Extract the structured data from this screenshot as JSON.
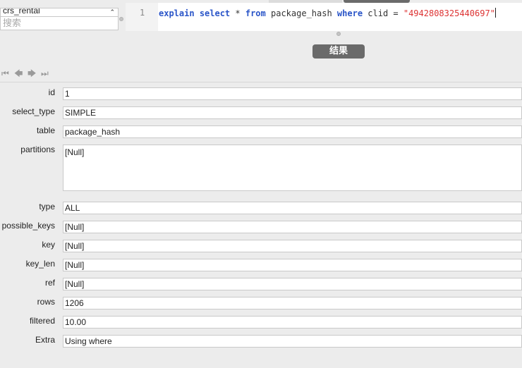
{
  "sidebar": {
    "database_select": "crs_rental",
    "search_placeholder": "搜索"
  },
  "editor": {
    "line_number": "1",
    "tokens": {
      "k1": "explain",
      "k2": "select",
      "t1": " * ",
      "k3": "from",
      "t2": " package_hash ",
      "k4": "where",
      "t3": " clid = ",
      "s1": "\"4942808325440697\""
    }
  },
  "toolbar": {
    "result_label": "结果"
  },
  "navigation": {
    "icons": [
      "first-record-icon",
      "previous-record-icon",
      "next-record-icon",
      "last-record-icon"
    ]
  },
  "record": {
    "fields": [
      {
        "label": "id",
        "value": "1"
      },
      {
        "label": "select_type",
        "value": "SIMPLE"
      },
      {
        "label": "table",
        "value": "package_hash"
      },
      {
        "label": "partitions",
        "value": "[Null]"
      },
      {
        "label": "type",
        "value": "ALL"
      },
      {
        "label": "possible_keys",
        "value": "[Null]"
      },
      {
        "label": "key",
        "value": "[Null]"
      },
      {
        "label": "key_len",
        "value": "[Null]"
      },
      {
        "label": "ref",
        "value": "[Null]"
      },
      {
        "label": "rows",
        "value": "1206"
      },
      {
        "label": "filtered",
        "value": "10.00"
      },
      {
        "label": "Extra",
        "value": "Using where"
      }
    ]
  },
  "colors": {
    "keyword": "#2a55c8",
    "string": "#dd3333",
    "button_bg": "#6a6a6a"
  }
}
